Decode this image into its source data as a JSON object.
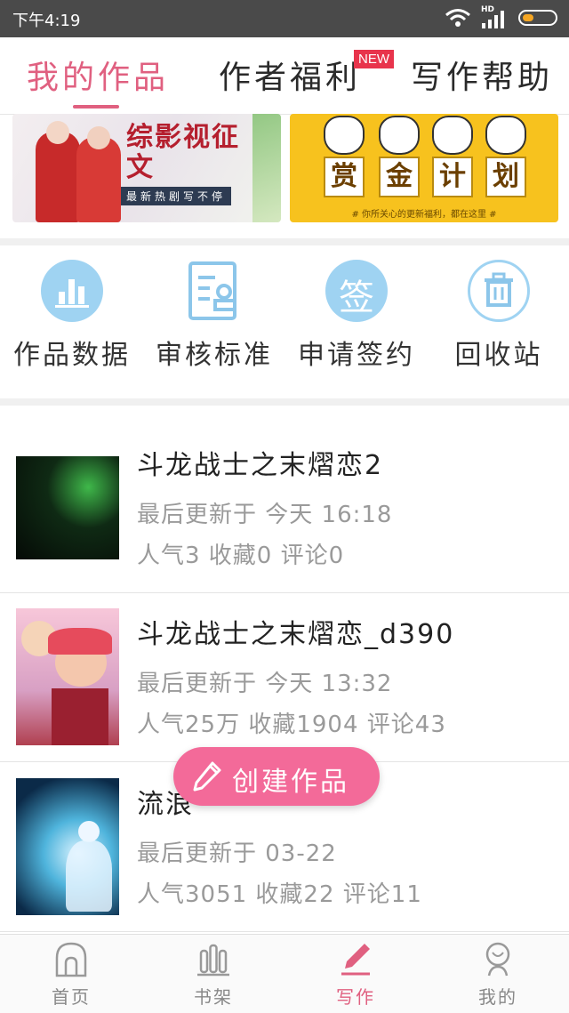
{
  "status_bar": {
    "time": "下午4:19",
    "network": "HD"
  },
  "tabs": [
    {
      "label": "我的作品",
      "active": true
    },
    {
      "label": "作者福利",
      "active": false,
      "badge": "NEW"
    },
    {
      "label": "写作帮助",
      "active": false
    }
  ],
  "banners": {
    "left": {
      "title": "综影视征文",
      "subtitle": "最新热剧写不停"
    },
    "right": {
      "chars": [
        "赏",
        "金",
        "计",
        "划"
      ],
      "footer": "# 你所关心的更新福利，都在这里 #"
    }
  },
  "tools": [
    {
      "label": "作品数据",
      "icon": "bar-chart-icon",
      "color": "#9fd3f2"
    },
    {
      "label": "审核标准",
      "icon": "document-review-icon",
      "color": "#9fd3f2"
    },
    {
      "label": "申请签约",
      "icon": "sign-badge-icon",
      "color": "#9fd3f2",
      "glyph": "签"
    },
    {
      "label": "回收站",
      "icon": "trash-icon",
      "color": "#9fd3f2"
    }
  ],
  "works": [
    {
      "title": "斗龙战士之末熠恋2",
      "updated": "最后更新于 今天 16:18",
      "stats": "人气3 收藏0 评论0",
      "cover": "dark-green-cover"
    },
    {
      "title": "斗龙战士之末熠恋_d390",
      "updated": "最后更新于 今天 13:32",
      "stats": "人气25万 收藏1904 评论43",
      "cover": "cartoon-characters-cover"
    },
    {
      "title": "流浪",
      "updated": "最后更新于 03-22",
      "stats": "人气3051 收藏22 评论11",
      "cover": "blue-fairy-cover"
    }
  ],
  "create_button": {
    "label": "创建作品"
  },
  "bottom_nav": [
    {
      "label": "首页",
      "icon": "home-icon",
      "active": false
    },
    {
      "label": "书架",
      "icon": "bookshelf-icon",
      "active": false
    },
    {
      "label": "写作",
      "icon": "pen-icon",
      "active": true
    },
    {
      "label": "我的",
      "icon": "profile-icon",
      "active": false
    }
  ],
  "colors": {
    "accent": "#e06080",
    "button": "#f36a99",
    "tool_icon": "#9fd3f2",
    "status_bar": "#4a4a4a"
  }
}
